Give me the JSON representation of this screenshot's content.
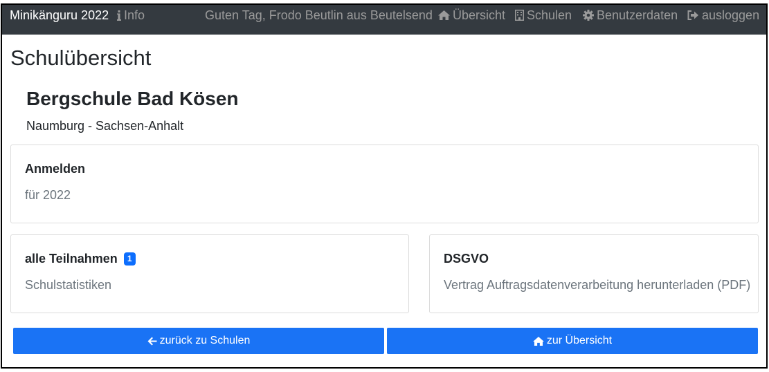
{
  "navbar": {
    "brand": "Minikänguru 2022",
    "info_label": "Info",
    "greeting": "Guten Tag, Frodo Beutlin aus Beutelsend",
    "overview_label": "Übersicht",
    "schools_label": "Schulen",
    "userdata_label": "Benutzerdaten",
    "logout_label": "ausloggen",
    "icons": [
      "info-icon",
      "home-icon",
      "building-icon",
      "gear-icon",
      "logout-icon"
    ]
  },
  "page": {
    "title": "Schulübersicht"
  },
  "school": {
    "name": "Bergschule Bad Kösen",
    "location": "Naumburg - Sachsen-Anhalt"
  },
  "cards": {
    "register": {
      "title": "Anmelden",
      "text": "für 2022"
    },
    "teilnahmen": {
      "title": "alle Teilnahmen",
      "badge": "1",
      "text": "Schulstatistiken"
    },
    "dsgvo": {
      "title": "DSGVO",
      "text": "Vertrag Auftragsdatenverarbeitung herunterladen (PDF)"
    }
  },
  "buttons": {
    "back_label": "zurück zu Schulen",
    "home_label": "zur Übersicht"
  },
  "colors": {
    "navbar_bg": "#343a40",
    "primary": "#1a73f5",
    "badge": "#0d6efd",
    "muted_text": "#6c757d"
  }
}
